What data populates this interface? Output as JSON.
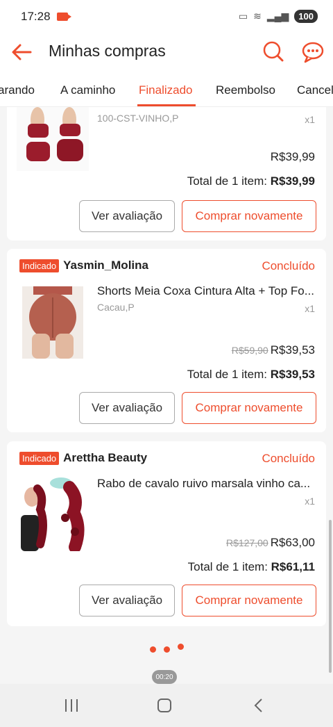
{
  "status_bar": {
    "time": "17:28",
    "battery": "100"
  },
  "header": {
    "title": "Minhas compras"
  },
  "tabs": [
    {
      "label": "arando"
    },
    {
      "label": "A caminho"
    },
    {
      "label": "Finalizado"
    },
    {
      "label": "Reembolso"
    },
    {
      "label": "Cancel"
    }
  ],
  "orders": [
    {
      "variant": "100-CST-VINHO,P",
      "qty": "x1",
      "price": "R$39,99",
      "total_label": "Total de 1 item:",
      "total_value": "R$39,99",
      "review_label": "Ver avaliação",
      "buy_again_label": "Comprar novamente"
    },
    {
      "badge": "Indicado",
      "shop": "Yasmin_Molina",
      "status": "Concluído",
      "product": "Shorts Meia Coxa Cintura Alta + Top Fo...",
      "variant": "Cacau,P",
      "qty": "x1",
      "old_price": "R$59,90",
      "price": "R$39,53",
      "total_label": "Total de 1 item:",
      "total_value": "R$39,53",
      "review_label": "Ver avaliação",
      "buy_again_label": "Comprar novamente"
    },
    {
      "badge": "Indicado",
      "shop": "Arettha Beauty",
      "status": "Concluído",
      "product": "Rabo de cavalo ruivo marsala vinho ca...",
      "qty": "x1",
      "old_price": "R$127,00",
      "price": "R$63,00",
      "total_label": "Total de 1 item:",
      "total_value": "R$61,11",
      "review_label": "Ver avaliação",
      "buy_again_label": "Comprar novamente"
    }
  ],
  "recording_timer": "00:20",
  "colors": {
    "accent": "#ee4d2d"
  }
}
